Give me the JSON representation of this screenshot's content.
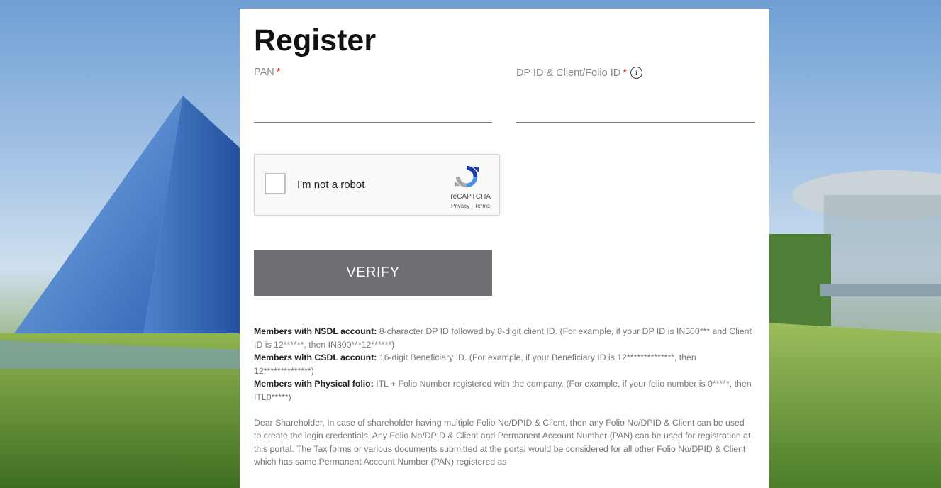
{
  "page": {
    "title": "Register"
  },
  "form": {
    "pan": {
      "label": "PAN",
      "required_mark": "*",
      "value": ""
    },
    "dp_id": {
      "label": "DP ID & Client/Folio ID",
      "required_mark": "*",
      "info_icon": "i",
      "value": ""
    },
    "captcha": {
      "label": "I'm not a robot",
      "brand": "reCAPTCHA",
      "privacy": "Privacy",
      "separator": " - ",
      "terms": "Terms"
    },
    "verify_label": "VERIFY"
  },
  "notes": {
    "nsdl": {
      "heading": "Members with NSDL account:",
      "text": " 8-character DP ID followed by 8-digit client ID. (For example, if your DP ID is IN300*** and Client ID is 12******, then IN300***12******)"
    },
    "csdl": {
      "heading": "Members with CSDL account:",
      "text": " 16-digit Beneficiary ID. (For example, if your Beneficiary ID is 12**************, then 12**************)"
    },
    "physical": {
      "heading": "Members with Physical folio:",
      "text": " ITL + Folio Number registered with the company. (For example, if your folio number is 0*****, then ITL0*****)"
    },
    "disclaimer": "Dear Shareholder, In case of shareholder having multiple Folio No/DPID & Client, then any Folio No/DPID & Client can be used to create the login credentials. Any Folio No/DPID & Client and Permanent Account Number (PAN) can be used for registration at this portal. The Tax forms or various documents submitted at the portal would be considered for all other Folio No/DPID & Client which has same Permanent Account Number (PAN) registered as"
  },
  "colors": {
    "required": "#e02020",
    "button": "#6d6d72",
    "heading": "#111111"
  },
  "icons": {
    "info": "info-icon",
    "recaptcha": "recaptcha-logo-icon"
  }
}
